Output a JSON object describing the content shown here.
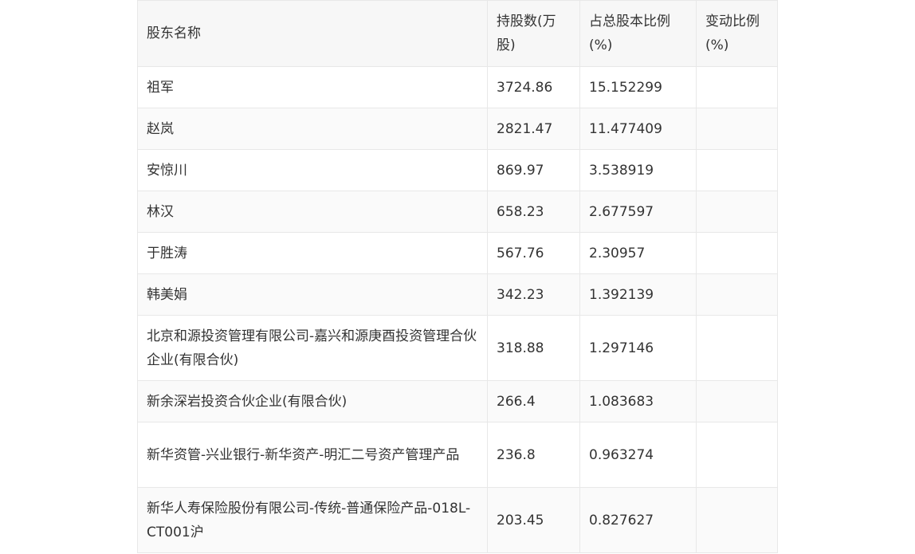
{
  "table": {
    "headers": [
      "股东名称",
      "持股数(万股)",
      "占总股本比例(%)",
      "变动比例(%)"
    ],
    "rows": [
      {
        "name": "祖军",
        "shares": "3724.86",
        "ratio": "15.152299",
        "change": ""
      },
      {
        "name": "赵岚",
        "shares": "2821.47",
        "ratio": "11.477409",
        "change": ""
      },
      {
        "name": "安惊川",
        "shares": "869.97",
        "ratio": "3.538919",
        "change": ""
      },
      {
        "name": "林汉",
        "shares": "658.23",
        "ratio": "2.677597",
        "change": ""
      },
      {
        "name": "于胜涛",
        "shares": "567.76",
        "ratio": "2.30957",
        "change": ""
      },
      {
        "name": "韩美娟",
        "shares": "342.23",
        "ratio": "1.392139",
        "change": ""
      },
      {
        "name": "北京和源投资管理有限公司-嘉兴和源庚酉投资管理合伙企业(有限合伙)",
        "shares": "318.88",
        "ratio": "1.297146",
        "change": ""
      },
      {
        "name": "新余深岩投资合伙企业(有限合伙)",
        "shares": "266.4",
        "ratio": "1.083683",
        "change": ""
      },
      {
        "name": "新华资管-兴业银行-新华资产-明汇二号资产管理产品",
        "shares": "236.8",
        "ratio": "0.963274",
        "change": ""
      },
      {
        "name": "新华人寿保险股份有限公司-传统-普通保险产品-018L-CT001沪",
        "shares": "203.45",
        "ratio": "0.827627",
        "change": ""
      }
    ]
  }
}
